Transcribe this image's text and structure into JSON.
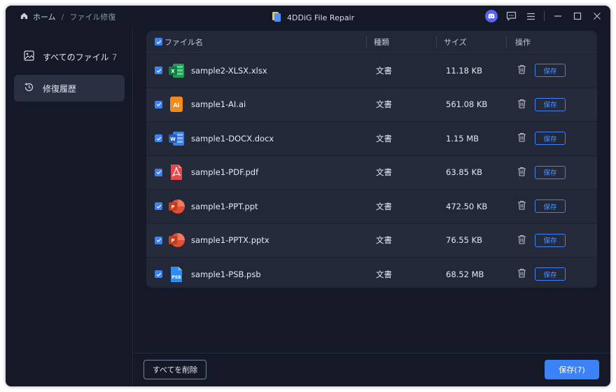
{
  "breadcrumb": {
    "home": "ホーム",
    "separator": "/",
    "current": "ファイル修復"
  },
  "app": {
    "title": "4DDiG File Repair"
  },
  "sidebar": {
    "items": [
      {
        "label": "すべてのファイル",
        "count": "7",
        "icon": "image-icon"
      },
      {
        "label": "修復履歴",
        "icon": "history-icon",
        "active": true
      }
    ]
  },
  "table": {
    "headers": {
      "name": "ファイル名",
      "type": "種類",
      "size": "サイズ",
      "ops": "操作"
    },
    "save_label": "保存",
    "rows": [
      {
        "name": "sample2-XLSX.xlsx",
        "type": "文書",
        "size": "11.18 KB",
        "icon": "excel-icon"
      },
      {
        "name": "sample1-AI.ai",
        "type": "文書",
        "size": "561.08 KB",
        "icon": "illustrator-icon"
      },
      {
        "name": "sample1-DOCX.docx",
        "type": "文書",
        "size": "1.15 MB",
        "icon": "word-icon"
      },
      {
        "name": "sample1-PDF.pdf",
        "type": "文書",
        "size": "63.85 KB",
        "icon": "pdf-icon"
      },
      {
        "name": "sample1-PPT.ppt",
        "type": "文書",
        "size": "472.50 KB",
        "icon": "powerpoint-icon"
      },
      {
        "name": "sample1-PPTX.pptx",
        "type": "文書",
        "size": "76.55 KB",
        "icon": "powerpoint-icon"
      },
      {
        "name": "sample1-PSB.psb",
        "type": "文書",
        "size": "68.52 MB",
        "icon": "photoshop-icon"
      }
    ]
  },
  "footer": {
    "delete_all": "すべてを削除",
    "save_all": "保存(7)"
  },
  "colors": {
    "accent": "#3b82f6",
    "background": "#141827",
    "panel": "#232838"
  }
}
